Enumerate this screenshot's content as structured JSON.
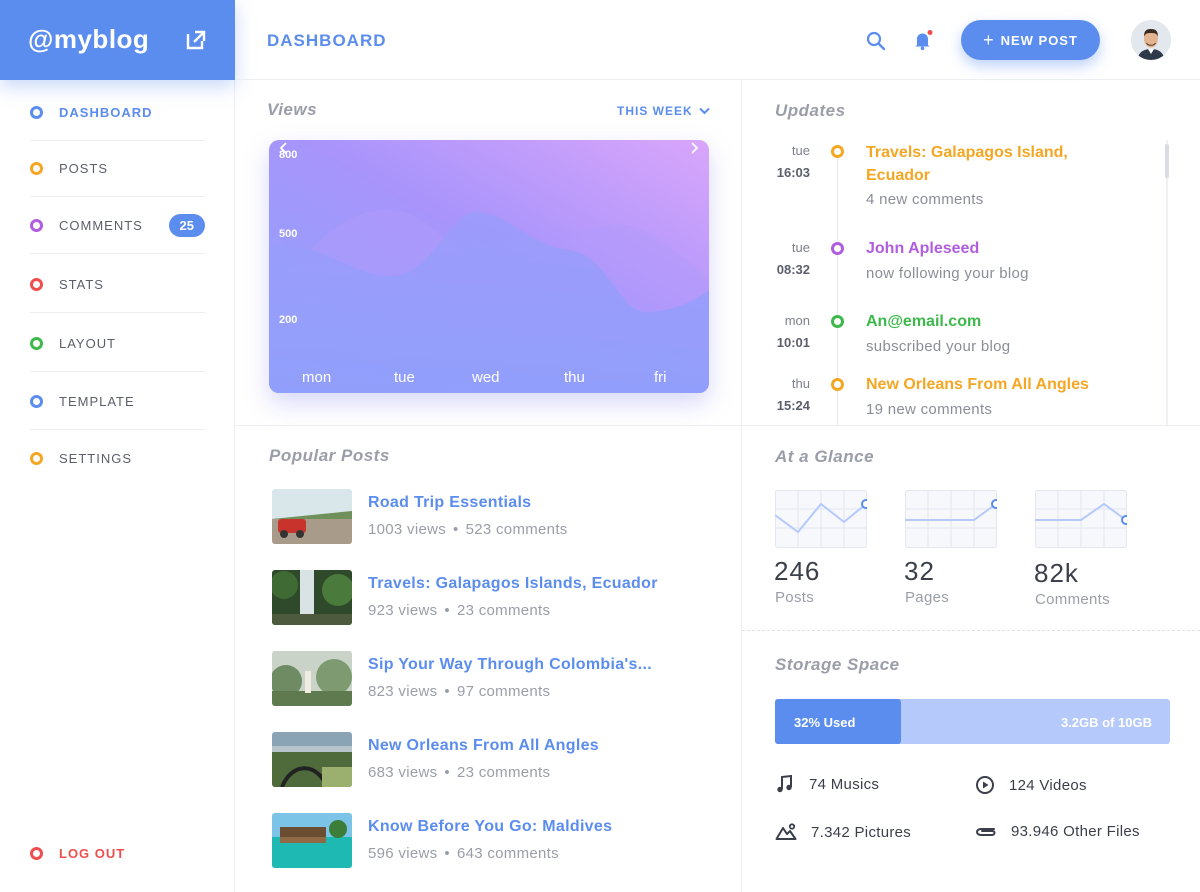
{
  "brand": {
    "name": "@myblog"
  },
  "topbar": {
    "title": "DASHBOARD",
    "new_post_label": "NEW POST"
  },
  "colors": {
    "accent": "#5b8def",
    "orange": "#f5a623",
    "purple": "#b05ddf",
    "red": "#ef4e4e",
    "green": "#3cb94a"
  },
  "sidebar": {
    "items": [
      {
        "label": "DASHBOARD",
        "color": "#5b8def",
        "active": true
      },
      {
        "label": "POSTS",
        "color": "#f5a623"
      },
      {
        "label": "COMMENTS",
        "color": "#b05ddf",
        "badge": "25"
      },
      {
        "label": "STATS",
        "color": "#ef4e4e"
      },
      {
        "label": "LAYOUT",
        "color": "#3cb94a"
      },
      {
        "label": "TEMPLATE",
        "color": "#5b8def"
      },
      {
        "label": "SETTINGS",
        "color": "#f5a623"
      }
    ],
    "logout_label": "LOG OUT"
  },
  "views": {
    "title": "Views",
    "range_label": "THIS WEEK",
    "chart_data": {
      "type": "area",
      "categories": [
        "mon",
        "tue",
        "wed",
        "thu",
        "fri"
      ],
      "y_ticks": [
        "800",
        "500",
        "200"
      ]
    }
  },
  "updates": {
    "title": "Updates",
    "items": [
      {
        "day": "tue",
        "time": "16:03",
        "title": "Travels: Galapagos Island, Ecuador",
        "sub": "4 new comments",
        "color": "#f5a623"
      },
      {
        "day": "tue",
        "time": "08:32",
        "title": "John Apleseed",
        "sub": "now following your blog",
        "color": "#b05ddf"
      },
      {
        "day": "mon",
        "time": "10:01",
        "title": "An@email.com",
        "sub": "subscribed your blog",
        "color": "#3cb94a"
      },
      {
        "day": "thu",
        "time": "15:24",
        "title": "New Orleans From All Angles",
        "sub": "19 new comments",
        "color": "#f5a623"
      }
    ]
  },
  "popular": {
    "title": "Popular Posts",
    "posts": [
      {
        "title": "Road Trip Essentials",
        "views": "1003 views",
        "comments": "523 comments"
      },
      {
        "title": "Travels: Galapagos Islands, Ecuador",
        "views": "923 views",
        "comments": "23 comments"
      },
      {
        "title": "Sip Your Way Through Colombia's...",
        "views": "823 views",
        "comments": "97 comments"
      },
      {
        "title": "New Orleans From All Angles",
        "views": "683 views",
        "comments": "23 comments"
      },
      {
        "title": "Know Before You Go: Maldives",
        "views": "596 views",
        "comments": "643 comments"
      }
    ]
  },
  "glance": {
    "title": "At a Glance",
    "items": [
      {
        "value": "246",
        "label": "Posts"
      },
      {
        "value": "32",
        "label": "Pages"
      },
      {
        "value": "82k",
        "label": "Comments"
      }
    ]
  },
  "storage": {
    "title": "Storage Space",
    "used_label": "32% Used",
    "used_fraction": 0.32,
    "total_label": "3.2GB of 10GB",
    "stats": [
      {
        "icon": "music-icon",
        "label": "74 Musics"
      },
      {
        "icon": "play-circle-icon",
        "label": "124 Videos"
      },
      {
        "icon": "picture-icon",
        "label": "7.342 Pictures"
      },
      {
        "icon": "paperclip-icon",
        "label": "93.946 Other Files"
      }
    ]
  }
}
